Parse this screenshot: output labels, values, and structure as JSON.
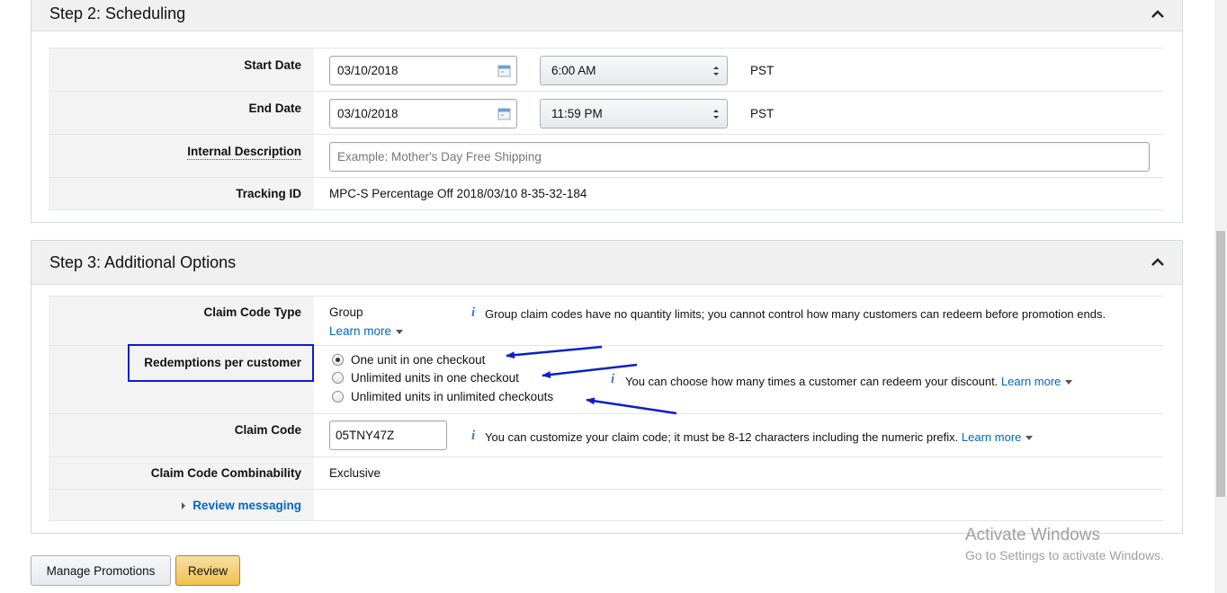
{
  "step2": {
    "title": "Step 2: Scheduling",
    "start_date_label": "Start Date",
    "start_date_value": "03/10/2018",
    "start_time_value": "6:00 AM",
    "start_tz": "PST",
    "end_date_label": "End Date",
    "end_date_value": "03/10/2018",
    "end_time_value": "11:59 PM",
    "end_tz": "PST",
    "internal_description_label": "Internal Description",
    "internal_description_placeholder": "Example: Mother's Day Free Shipping",
    "tracking_id_label": "Tracking ID",
    "tracking_id_value": "MPC-S Percentage Off 2018/03/10 8-35-32-184"
  },
  "step3": {
    "title": "Step 3: Additional Options",
    "claim_code_type_label": "Claim Code Type",
    "claim_code_type_value": "Group",
    "claim_code_type_learn_more": "Learn more",
    "claim_code_type_hint": "Group claim codes have no quantity limits; you cannot control how many customers can redeem before promotion ends.",
    "redemptions_label": "Redemptions per customer",
    "redemption_options": [
      {
        "label": "One unit in one checkout",
        "checked": true
      },
      {
        "label": "Unlimited units in one checkout",
        "checked": false
      },
      {
        "label": "Unlimited units in unlimited checkouts",
        "checked": false
      }
    ],
    "redemptions_hint": "You can choose how many times a customer can redeem your discount.",
    "redemptions_learn_more": "Learn more",
    "claim_code_label": "Claim Code",
    "claim_code_value": "05TNY47Z",
    "claim_code_hint": "You can customize your claim code; it must be 8-12 characters including the numeric prefix.",
    "claim_code_learn_more": "Learn more",
    "combinability_label": "Claim Code Combinability",
    "combinability_value": "Exclusive",
    "review_messaging_label": "Review messaging"
  },
  "footer": {
    "manage_promotions_label": "Manage Promotions",
    "review_label": "Review"
  },
  "watermark": {
    "title": "Activate Windows",
    "subtitle": "Go to Settings to activate Windows."
  },
  "colors": {
    "link": "#0066c0",
    "annotation": "#0a1ecd",
    "primary_button": "#f0c14b"
  }
}
